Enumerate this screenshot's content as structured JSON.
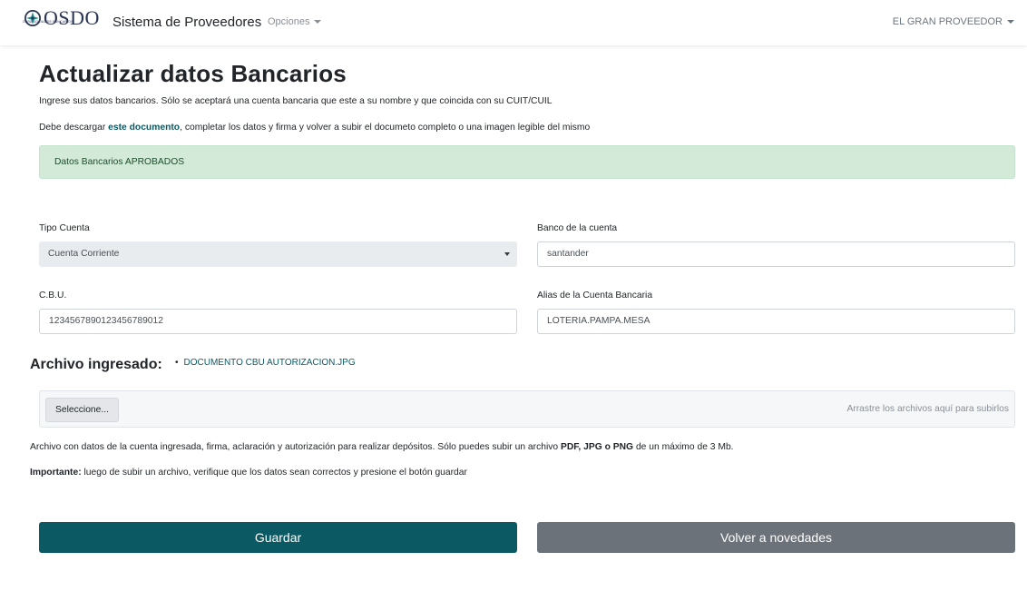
{
  "navbar": {
    "logo_text": "OSDO",
    "logo_subtext": "OBRA SOCIAL DE BANCARIOS",
    "brand_title": "Sistema de Proveedores",
    "menu_opciones": "Opciones",
    "user_name": "EL GRAN PROVEEDOR"
  },
  "page": {
    "title": "Actualizar datos Bancarios",
    "intro": "Ingrese sus datos bancarios. Sólo se aceptará una cuenta bancaria que este a su nombre y que coincida con su CUIT/CUIL",
    "intro2_before": "Debe descargar ",
    "intro2_link": "este documento",
    "intro2_after": ", completar los datos y firma y volver a subir el documeto completo o una imagen legible del mismo"
  },
  "alert": {
    "text": "Datos Bancarios APROBADOS",
    "color": "#d3ead9"
  },
  "form": {
    "tipo_cuenta_label": "Tipo Cuenta",
    "tipo_cuenta_value": "Cuenta Corriente",
    "banco_label": "Banco de la cuenta",
    "banco_value": "santander",
    "cbu_label": "C.B.U.",
    "cbu_value": "1234567890123456789012",
    "alias_label": "Alias de la Cuenta Bancaria",
    "alias_value": "LOTERIA.PAMPA.MESA"
  },
  "archivo": {
    "title": "Archivo ingresado:",
    "file_name": "DOCUMENTO CBU AUTORIZACION.JPG",
    "select_button": "Seleccione...",
    "drop_hint": "Arrastre los archivos aquí para subirlos"
  },
  "help": {
    "line1_before": "Archivo con datos de la cuenta ingresada, firma, aclaración y autorización para realizar depósitos. Sólo puedes subir un archivo ",
    "line1_bold": "PDF, JPG o PNG",
    "line1_after": " de un máximo de 3 Mb.",
    "line2_bold": "Importante:",
    "line2_after": " luego de subir un archivo, verifique que los datos sean correctos y presione el botón guardar"
  },
  "actions": {
    "guardar": "Guardar",
    "volver": "Volver a novedades",
    "primary_color": "#0b5a63",
    "secondary_color": "#6c7279"
  }
}
